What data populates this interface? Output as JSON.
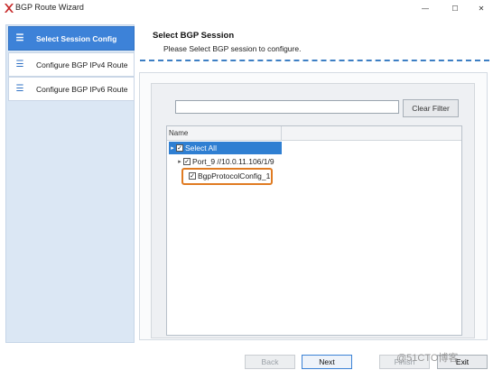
{
  "window": {
    "title": "BGP Route Wizard",
    "logo_icon": "red-x-logo-icon",
    "controls": {
      "minimize": "—",
      "maximize": "☐",
      "close": "✕"
    }
  },
  "sidebar": {
    "items": [
      {
        "label": "Select Session Config",
        "icon": "list-icon",
        "active": true
      },
      {
        "label": "Configure BGP IPv4 Route",
        "icon": "list-icon",
        "active": false
      },
      {
        "label": "Configure BGP IPv6 Route",
        "icon": "list-icon",
        "active": false
      }
    ]
  },
  "header": {
    "title": "Select BGP Session",
    "subtitle": "Please Select BGP session to configure."
  },
  "filter": {
    "value": "",
    "placeholder": "",
    "button_label": "Clear Filter"
  },
  "tree": {
    "column_header": "Name",
    "rows": [
      {
        "label": "Select All",
        "checked": true,
        "selected": true,
        "expander": "▸"
      },
      {
        "label": "Port_9 //10.0.11.106/1/9",
        "checked": true,
        "selected": false,
        "expander": "▸"
      },
      {
        "label": "BgpProtocolConfig_1",
        "checked": true,
        "selected": false,
        "expander": ""
      }
    ]
  },
  "footer": {
    "back_label": "Back",
    "next_label": "Next",
    "finish_label": "Finish",
    "exit_label": "Exit"
  },
  "watermark": "@51CTO博客",
  "colors": {
    "accent": "#3d82d8",
    "selection": "#2f7fd2",
    "highlight": "#e07b22",
    "sidebar_bg": "#dbe7f4"
  }
}
